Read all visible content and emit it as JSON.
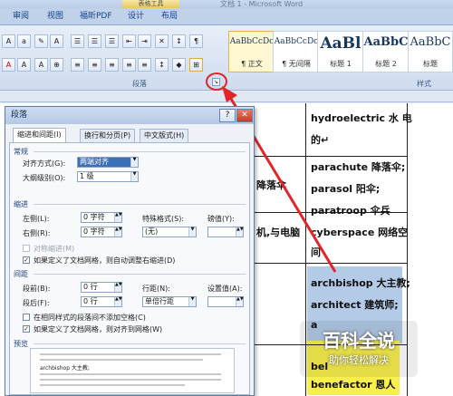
{
  "window": {
    "context_tab": "表格工具",
    "doc_title": "文档 1 - Microsoft Word"
  },
  "tabs": [
    "审阅",
    "视图",
    "福昕PDF",
    "设计",
    "布局"
  ],
  "ribbon": {
    "paragraph_group": "段落",
    "styles_group": "样式",
    "styles": [
      {
        "preview": "AaBbCcDc",
        "name": "¶ 正文"
      },
      {
        "preview": "AaBbCcDc",
        "name": "¶ 无间隔"
      },
      {
        "preview": "AaBl",
        "name": "标题 1"
      },
      {
        "preview": "AaBbC",
        "name": "标题 2"
      },
      {
        "preview": "AaBbC",
        "name": "标题"
      }
    ]
  },
  "document": {
    "right_col": [
      "hydroelectric 水 电",
      "的↵",
      "parachute 降落伞;",
      "parasol 阳伞;",
      "paratroop 伞兵",
      "cyberspace 网络空",
      "间",
      "archbishop 大主教;",
      "architect 建筑师;",
      "a",
      "bel",
      "benefactor 恩人"
    ],
    "mid_col": [
      "降落伞",
      "机,与电脑"
    ]
  },
  "dialog": {
    "title": "段落",
    "help": "?",
    "close": "✕",
    "tabs": [
      "缩进和间距(I)",
      "换行和分页(P)",
      "中文版式(H)"
    ],
    "general": {
      "section": "常规",
      "align_label": "对齐方式(G):",
      "align_value": "两端对齐",
      "outline_label": "大纲级别(O):",
      "outline_value": "1 级"
    },
    "indent": {
      "section": "缩进",
      "left_label": "左侧(L):",
      "left_value": "0 字符",
      "right_label": "右侧(R):",
      "right_value": "0 字符",
      "special_label": "特殊格式(S):",
      "special_value": "(无)",
      "by_label": "磅值(Y):",
      "mirror_label": "对称缩进(M)",
      "grid_adjust": "如果定义了文档网格，则自动调整右缩进(D)"
    },
    "spacing": {
      "section": "间距",
      "before_label": "段前(B):",
      "before_value": "0 行",
      "after_label": "段后(F):",
      "after_value": "0 行",
      "line_label": "行距(N):",
      "line_value": "单倍行距",
      "at_label": "设置值(A):",
      "no_space_label": "在相同样式的段落间不添加空格(C)",
      "snap_grid_label": "如果定义了文档网格，则对齐到网格(W)"
    },
    "preview": {
      "section": "预览",
      "sample": "archbishop 大主教;"
    }
  },
  "watermark": {
    "title": "百科全说",
    "subtitle": "助你轻松解决"
  }
}
